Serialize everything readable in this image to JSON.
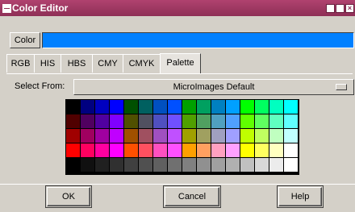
{
  "window": {
    "title": "Color Editor"
  },
  "color": {
    "label": "Color",
    "current_hex": "#0080ff"
  },
  "tabs": [
    "RGB",
    "HIS",
    "HBS",
    "CMY",
    "CMYK",
    "Palette"
  ],
  "active_tab": "Palette",
  "palette": {
    "select_label": "Select From:",
    "selected": "MicroImages Default",
    "rows": [
      [
        "#000000",
        "#000080",
        "#0000c0",
        "#0000ff",
        "#005000",
        "#006060",
        "#0050c0",
        "#0050ff",
        "#00a000",
        "#00a060",
        "#0080c0",
        "#00a0ff",
        "#00ff00",
        "#00ff60",
        "#00ffc0",
        "#00ffff"
      ],
      [
        "#500000",
        "#500060",
        "#5000a0",
        "#8000ff",
        "#505000",
        "#505060",
        "#5050c0",
        "#7050ff",
        "#50a000",
        "#50a060",
        "#50a0c0",
        "#50a0ff",
        "#60ff00",
        "#60ff60",
        "#60ffc0",
        "#60ffff"
      ],
      [
        "#a00000",
        "#a00060",
        "#a000a0",
        "#c000ff",
        "#a05000",
        "#a05060",
        "#a050c0",
        "#c050ff",
        "#a0a000",
        "#a0a060",
        "#a0a0c0",
        "#a0a0ff",
        "#c0ff00",
        "#c0ff60",
        "#c0ffc0",
        "#c0ffff"
      ],
      [
        "#ff0000",
        "#ff0060",
        "#ff00a0",
        "#ff00ff",
        "#ff5000",
        "#ff5060",
        "#ff50c0",
        "#ff50ff",
        "#ffa000",
        "#ffa060",
        "#ffa0c0",
        "#ffa0ff",
        "#ffff00",
        "#ffff60",
        "#ffffc0",
        "#ffffff"
      ],
      [
        "#000000",
        "#101010",
        "#202020",
        "#303030",
        "#404040",
        "#505050",
        "#606060",
        "#707070",
        "#808080",
        "#909090",
        "#a0a0a0",
        "#b0b0b0",
        "#c0c0c0",
        "#d8d8d8",
        "#ececec",
        "#ffffff"
      ]
    ]
  },
  "buttons": {
    "ok": "OK",
    "cancel": "Cancel",
    "help": "Help"
  }
}
